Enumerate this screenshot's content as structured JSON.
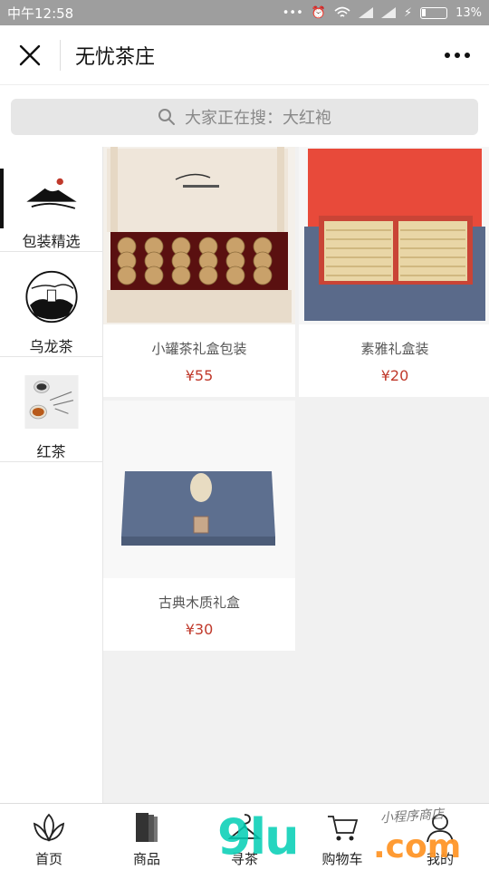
{
  "status_bar": {
    "time": "中午12:58",
    "battery": "13%"
  },
  "nav": {
    "title": "无忧茶庄"
  },
  "search": {
    "placeholder": "大家正在搜：大红袍"
  },
  "categories": [
    {
      "label": "包装精选",
      "icon": "mountains-icon",
      "active": true
    },
    {
      "label": "乌龙茶",
      "icon": "oolong-logo-icon",
      "active": false
    },
    {
      "label": "红茶",
      "icon": "tea-cup-icon",
      "active": false
    }
  ],
  "products": [
    {
      "name": "小罐茶礼盒包装",
      "price": "¥55"
    },
    {
      "name": "素雅礼盒装",
      "price": "¥20"
    },
    {
      "name": "古典木质礼盒",
      "price": "¥30"
    }
  ],
  "tabs": [
    {
      "label": "首页",
      "icon": "lotus-icon"
    },
    {
      "label": "商品",
      "icon": "books-icon"
    },
    {
      "label": "寻茶",
      "icon": "hanger-icon"
    },
    {
      "label": "购物车",
      "icon": "cart-icon"
    },
    {
      "label": "我的",
      "icon": "user-icon"
    }
  ],
  "watermark": {
    "main": "9lu",
    "domain": ".com",
    "tagline": "小程序商店"
  },
  "colors": {
    "price": "#c0392b",
    "status_bar": "#9e9e9e",
    "content_bg": "#f1f1f1"
  }
}
